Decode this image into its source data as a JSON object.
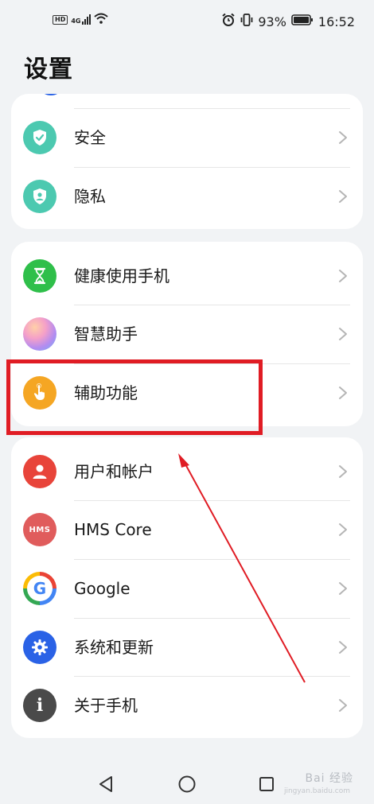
{
  "status_bar": {
    "left_icons": [
      "hd-icon",
      "4g-signal-icon",
      "wifi-icon"
    ],
    "hd_label": "HD",
    "network_label": "4G",
    "right_icons": [
      "alarm-icon",
      "vibrate-icon",
      "battery-icon"
    ],
    "battery": "93%",
    "time": "16:52"
  },
  "page": {
    "title": "设置"
  },
  "groups": [
    {
      "items": [
        {
          "label": "安全",
          "icon": "shield-check-icon",
          "icon_color": "#4cc9b0"
        },
        {
          "label": "隐私",
          "icon": "privacy-shield-icon",
          "icon_color": "#4cc9b0"
        }
      ]
    },
    {
      "items": [
        {
          "label": "健康使用手机",
          "icon": "hourglass-icon",
          "icon_color": "#2fbf4a"
        },
        {
          "label": "智慧助手",
          "icon": "assistant-orb-icon",
          "icon_color": "#c88cf0"
        },
        {
          "label": "辅助功能",
          "icon": "hand-pointer-icon",
          "icon_color": "#f5a623"
        }
      ]
    },
    {
      "items": [
        {
          "label": "用户和帐户",
          "icon": "user-icon",
          "icon_color": "#e8443a"
        },
        {
          "label": "HMS Core",
          "icon": "hms-icon",
          "icon_color": "#e05c5c",
          "icon_text": "HMS"
        },
        {
          "label": "Google",
          "icon": "google-icon",
          "icon_color": "#ffffff",
          "icon_text": "G"
        },
        {
          "label": "系统和更新",
          "icon": "gear-icon",
          "icon_color": "#2a62e6"
        },
        {
          "label": "关于手机",
          "icon": "info-icon",
          "icon_color": "#4a4a4a",
          "icon_text": "i"
        }
      ]
    }
  ],
  "nav_bar": {
    "back": "back-icon",
    "home": "home-icon",
    "recents": "recents-icon"
  },
  "watermark": {
    "text": "Bai 经验",
    "sub": "jingyan.baidu.com"
  },
  "colors": {
    "background": "#f1f3f5",
    "card": "#ffffff",
    "highlight": "#e01c24",
    "chevron": "#b5b5b5"
  }
}
